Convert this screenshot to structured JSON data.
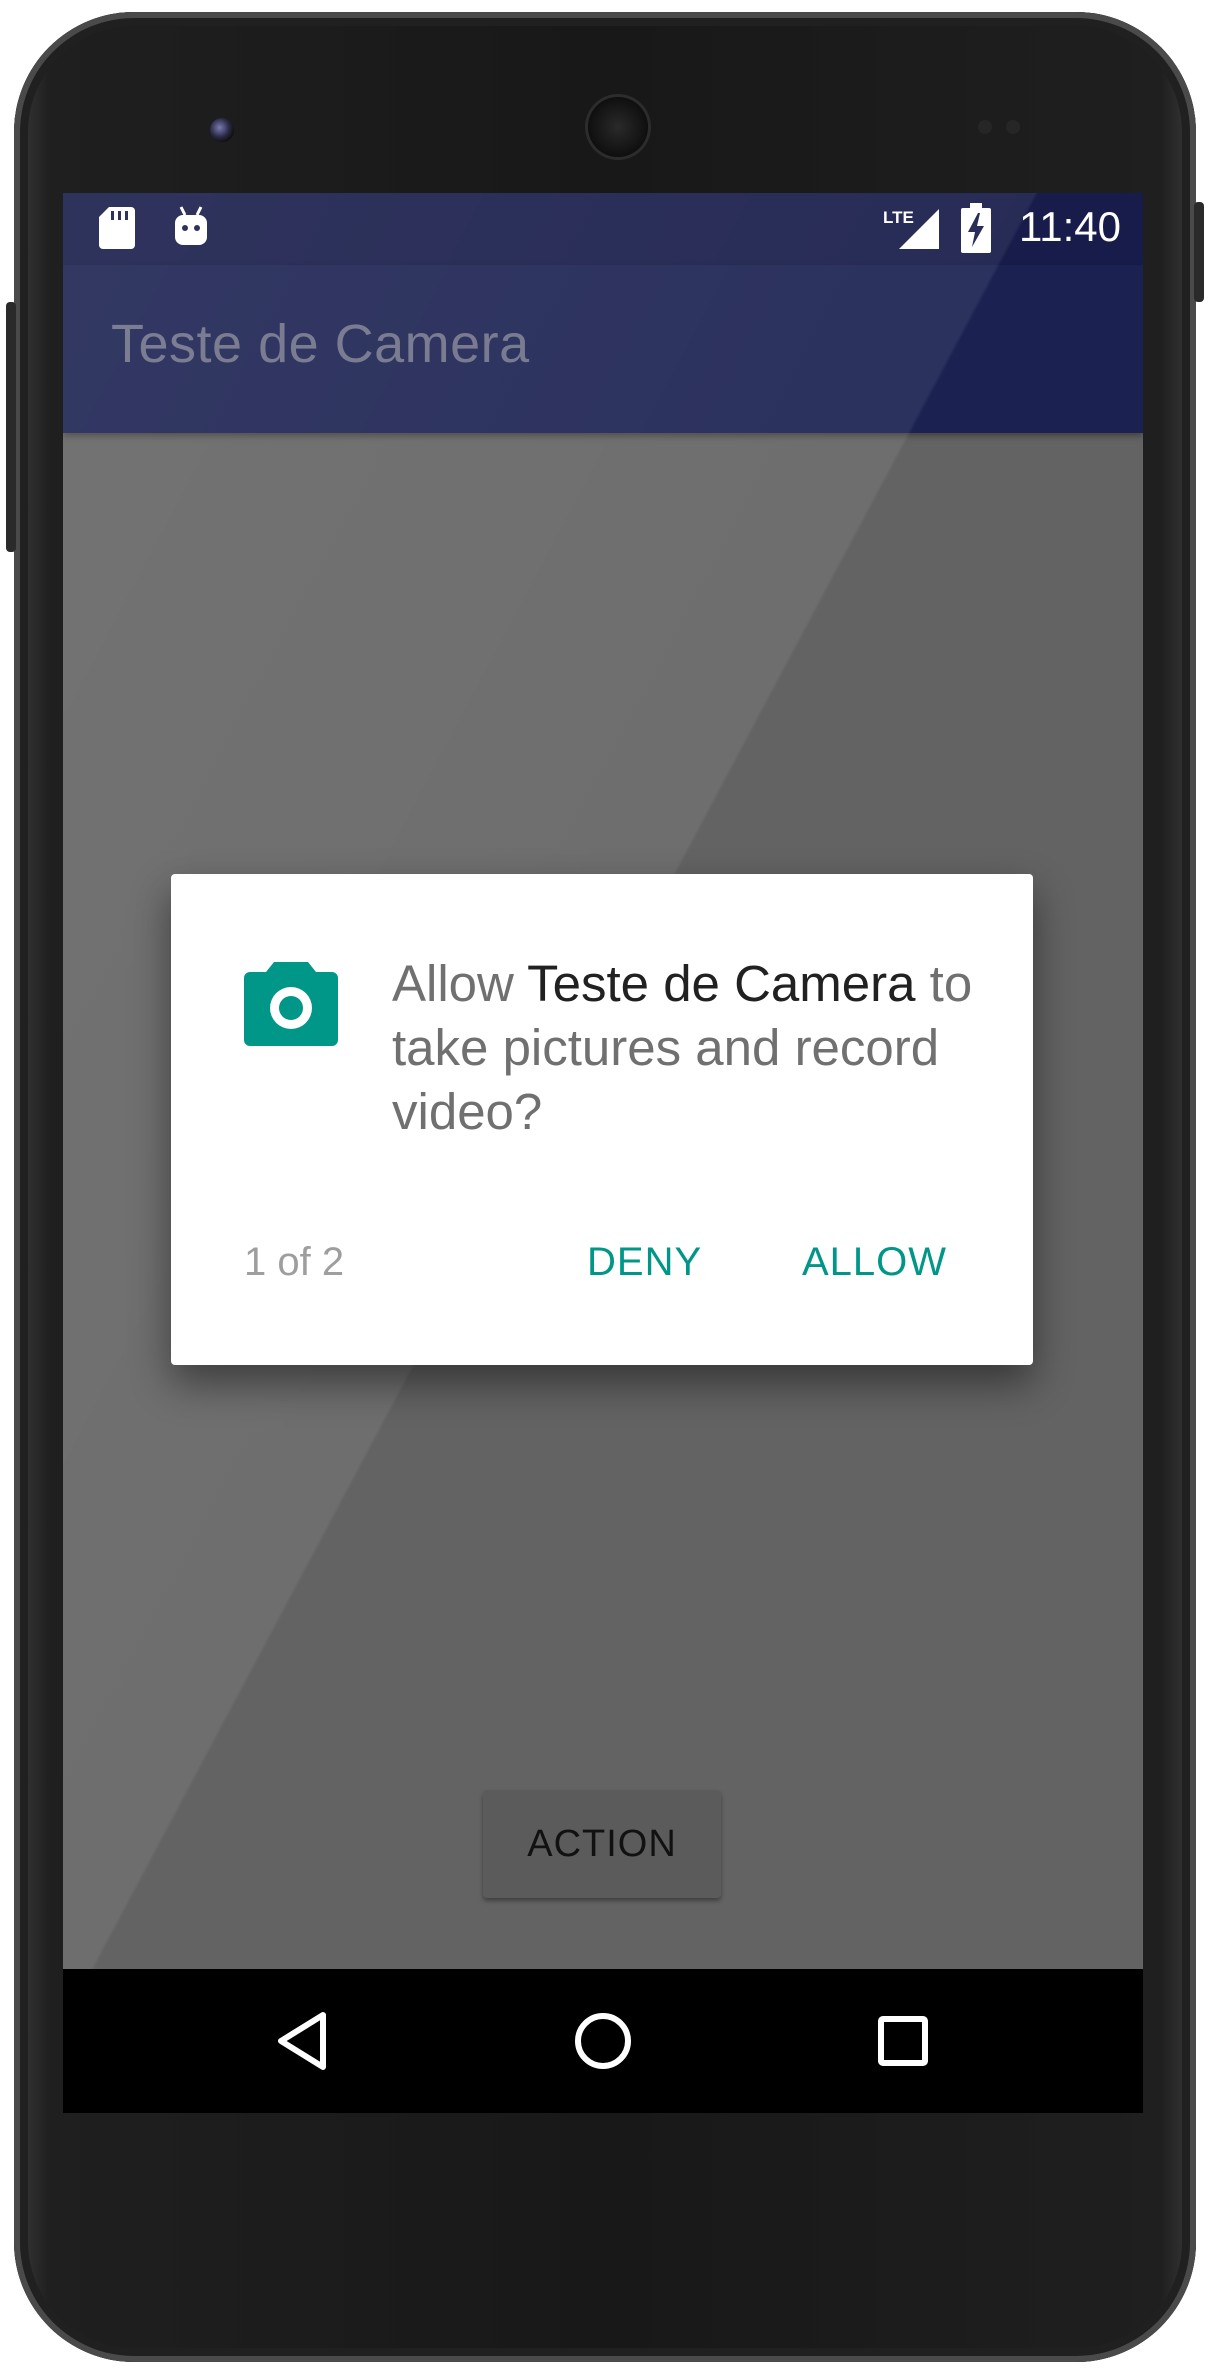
{
  "status_bar": {
    "time": "11:40",
    "network_label": "LTE",
    "icons": [
      "sd-card-icon",
      "android-debug-icon",
      "lte-signal-icon",
      "battery-charging-icon"
    ]
  },
  "app_bar": {
    "title": "Teste de Camera"
  },
  "main": {
    "action_button_label": "ACTION"
  },
  "permission_dialog": {
    "icon": "camera-icon",
    "message_prefix": "Allow ",
    "app_name": "Teste de Camera",
    "message_suffix": " to take pictures and record video?",
    "counter": "1 of 2",
    "deny_label": "DENY",
    "allow_label": "ALLOW"
  },
  "navigation_bar": {
    "buttons": [
      "back-icon",
      "home-icon",
      "recents-icon"
    ]
  },
  "colors": {
    "status_bar": "#171c4a",
    "app_bar": "#1b2251",
    "dimmed_content": "#636363",
    "dialog_accent": "#009688",
    "dialog_text": "#707070",
    "dialog_emphasis": "#212121"
  }
}
